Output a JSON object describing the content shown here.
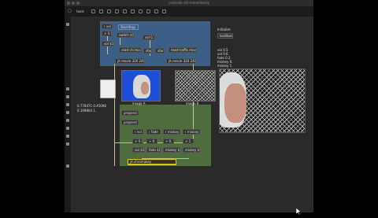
{
  "window": {
    "title": "controlla villi-immediately"
  },
  "toolbar": {
    "menu_label": "tools"
  },
  "objects": {
    "o1": "r vol",
    "o2": "> 0.00",
    "o3": "vol $1",
    "o4": "StartStop",
    "o5": "switch $1",
    "o6": "vol 0.1",
    "o7": "read ch.mov",
    "o8": "stop",
    "o9": "start",
    "o10": "read traffic.mov",
    "o11": "jit.movie 320 240",
    "o12": "jit.movie 320 240",
    "o13": "Initialize",
    "o14": "loadbang",
    "o15": "vol 0.5",
    "o16": "vol 0.6",
    "o17": "fade 0.2",
    "o18": "mixkey 0.",
    "o19": "mixkey 1.",
    "o20": "prepend X",
    "o21": "prepend Y",
    "o22": "r vol",
    "o23": "r fade",
    "o24": "r mixkey",
    "o25": "r mixkey",
    "o26": "> 0.0",
    "o27": "> 0.",
    "o28": "> 0.",
    "o29": "> 1.",
    "o30": "vol $1",
    "o31": "fade $1",
    "o32": "mixkey $1",
    "o33": "mixkey $1",
    "o34": "jit.chromakey"
  },
  "labels": {
    "image_a": "image A",
    "image_b": "image B",
    "readout_1": "0.778471 0.45098",
    "readout_2": "0.109804 1."
  },
  "colors": {
    "blue_panel": "#3c5f87",
    "green_panel": "#4f6d3c",
    "yellow_wire": "#c8b98b"
  }
}
